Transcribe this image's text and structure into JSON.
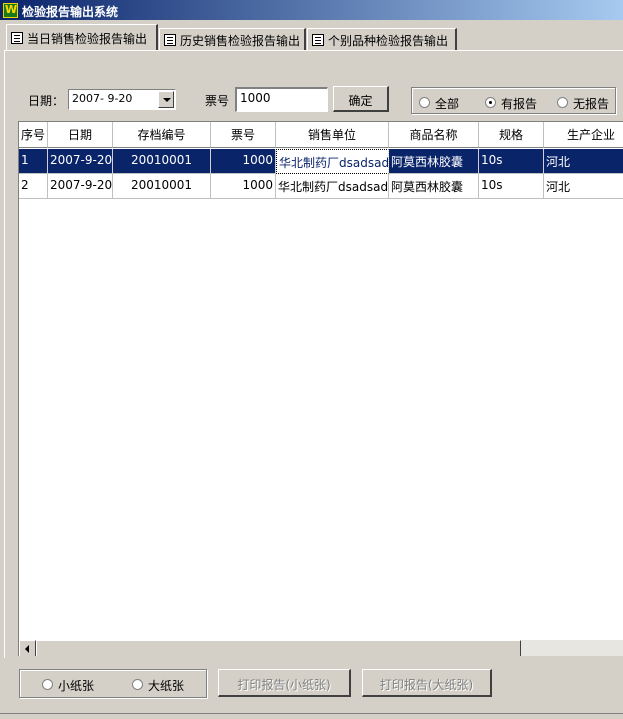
{
  "window": {
    "title": "检验报告输出系统"
  },
  "tabs": [
    {
      "label": "当日销售检验报告输出",
      "active": true
    },
    {
      "label": "历史销售检验报告输出",
      "active": false
    },
    {
      "label": "个别品种检验报告输出",
      "active": false
    }
  ],
  "filters": {
    "date_label": "日期：",
    "date_value": "2007- 9-20",
    "ticket_label": "票号",
    "ticket_value": "1000",
    "confirm_label": "确定",
    "report_filter": [
      {
        "label": "全部",
        "checked": false
      },
      {
        "label": "有报告",
        "checked": true
      },
      {
        "label": "无报告",
        "checked": false
      }
    ]
  },
  "table": {
    "columns": [
      "序号",
      "日期",
      "存档编号",
      "票号",
      "销售单位",
      "商品名称",
      "规格",
      "生产企业"
    ],
    "rows": [
      [
        "1",
        "2007-9-20",
        "20010001",
        "1000",
        "华北制药厂dsadsadsa",
        "阿莫西林胶囊",
        "10s",
        "河北"
      ],
      [
        "2",
        "2007-9-20",
        "20010001",
        "1000",
        "华北制药厂dsadsadsa",
        "阿莫西林胶囊",
        "10s",
        "河北"
      ]
    ],
    "selected_row": 0
  },
  "bottom": {
    "paper_options": [
      {
        "label": "小纸张",
        "checked": false
      },
      {
        "label": "大纸张",
        "checked": false
      }
    ],
    "print_small_label": "打印报告(小纸张)",
    "print_large_label": "打印报告(大纸张)"
  }
}
